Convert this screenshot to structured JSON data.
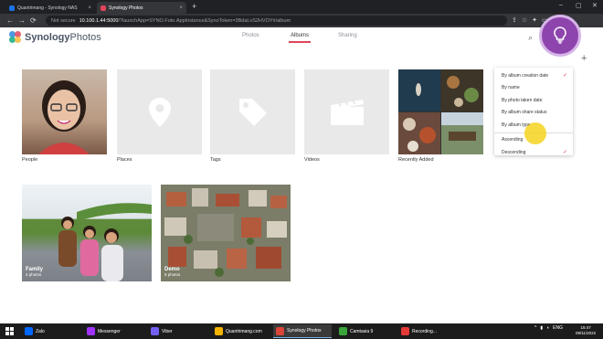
{
  "browser": {
    "tabs": [
      {
        "label": "Quantrimang - Synology NAS",
        "favicon_color": "#1a73e8"
      },
      {
        "label": "Synology Photos",
        "favicon_color": "#e0445a"
      }
    ],
    "new_tab": "+",
    "url": {
      "security": "Not secure",
      "host": "10.100.1.44:5000",
      "path": "/?launchApp=SYNO.Foto.AppInstance&SynoToken=3BdaLvS2HVOY#/album"
    }
  },
  "app": {
    "logo_bold": "Synology",
    "logo_rest": "Photos",
    "nav": [
      "Photos",
      "Albums",
      "Sharing"
    ],
    "nav_active": "Albums"
  },
  "albums": [
    {
      "label": "People",
      "icon": "person-photo"
    },
    {
      "label": "Places",
      "icon": "map-pin-icon"
    },
    {
      "label": "Tags",
      "icon": "tag-icon"
    },
    {
      "label": "Videos",
      "icon": "clapperboard-icon"
    },
    {
      "label": "Recently Added",
      "icon": "photo-collage"
    }
  ],
  "user_albums": [
    {
      "name": "Family",
      "count": "4 photos"
    },
    {
      "name": "Demo",
      "count": "5 photos"
    }
  ],
  "sort_menu": {
    "items": [
      {
        "label": "By album creation date",
        "checked": true
      },
      {
        "label": "By name",
        "checked": false
      },
      {
        "label": "By photo taken date",
        "checked": false
      },
      {
        "label": "By album share status",
        "checked": false
      },
      {
        "label": "By album type",
        "checked": false
      }
    ],
    "order": [
      {
        "label": "Ascending",
        "checked": false
      },
      {
        "label": "Descending",
        "checked": true
      }
    ]
  },
  "taskbar": {
    "items": [
      {
        "label": "Zalo",
        "color": "#0068ff"
      },
      {
        "label": "Messenger",
        "color": "#a033ff"
      },
      {
        "label": "Viber",
        "color": "#7360f2"
      },
      {
        "label": "Quantrimang.com",
        "color": "#f4b400"
      },
      {
        "label": "Synology Photos",
        "color": "#db4437"
      },
      {
        "label": "Camtasia 9",
        "color": "#3aa53a"
      },
      {
        "label": "Recording...",
        "color": "#e53935"
      }
    ],
    "active": "Synology Photos",
    "language": "ENG",
    "time": "15:47",
    "date": "09/11/2022"
  }
}
